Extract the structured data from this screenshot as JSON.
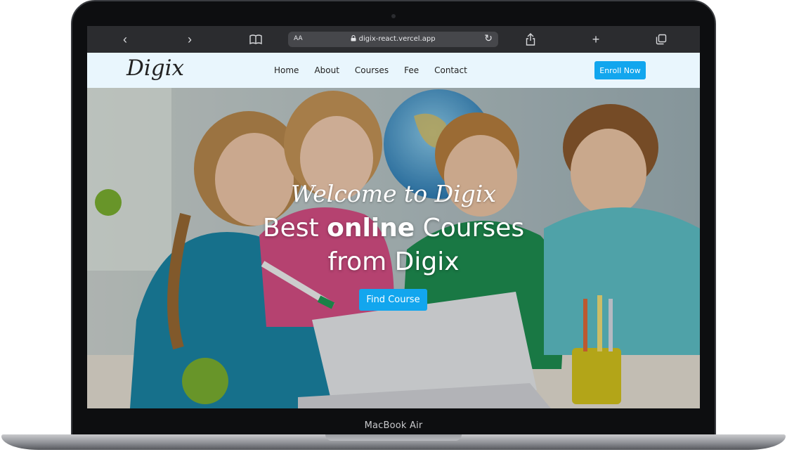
{
  "device": {
    "model_label": "MacBook Air"
  },
  "browser": {
    "back_icon": "‹",
    "forward_icon": "›",
    "reader_icon": "📖",
    "text_size_label": "AA",
    "url": "digix-react.vercel.app",
    "lock_icon": "🔒",
    "reload_icon": "↻",
    "share_icon": "⇧",
    "new_tab_icon": "+",
    "tabs_icon": "⧉"
  },
  "site": {
    "logo": "Digix",
    "nav": [
      "Home",
      "About",
      "Courses",
      "Fee",
      "Contact"
    ],
    "cta": "Enroll Now"
  },
  "hero": {
    "welcome": "Welcome to Digix",
    "headline_pre": "Best ",
    "headline_bold": "online",
    "headline_post": " Courses",
    "headline_line2": "from Digix",
    "button": "Find Course"
  },
  "colors": {
    "accent": "#12a6ee",
    "header_bg": "#e9f6fd",
    "toolbar_bg": "#2b2c2f"
  }
}
